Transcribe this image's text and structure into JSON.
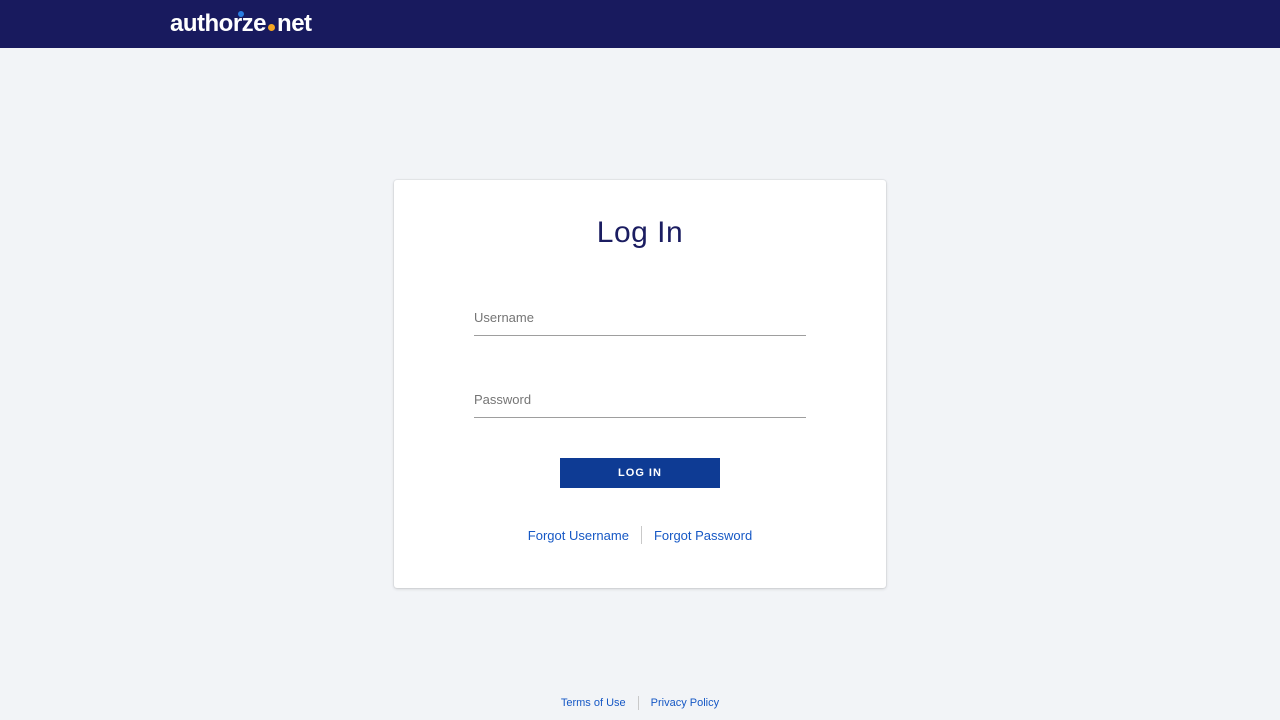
{
  "header": {
    "brand_part1": "author",
    "brand_part2": "ze",
    "brand_part3": "net"
  },
  "card": {
    "title": "Log In",
    "username_placeholder": "Username",
    "password_placeholder": "Password",
    "login_button": "LOG IN",
    "forgot_username": "Forgot Username",
    "forgot_password": "Forgot Password"
  },
  "footer": {
    "terms": "Terms of Use",
    "privacy": "Privacy Policy"
  }
}
